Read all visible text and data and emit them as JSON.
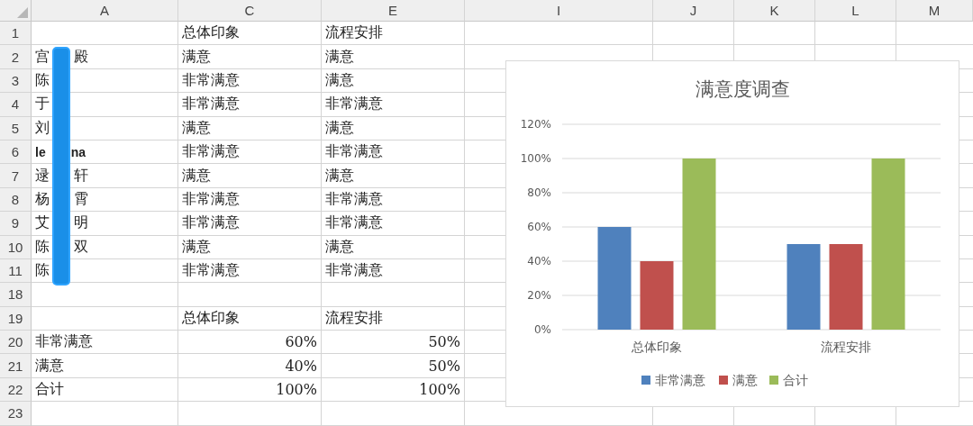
{
  "column_headers": [
    "A",
    "C",
    "E",
    "I",
    "J",
    "K",
    "L",
    "M"
  ],
  "rows": [
    {
      "row": "1",
      "name": [],
      "c": "总体印象",
      "e": "流程安排"
    },
    {
      "row": "2",
      "name": [
        "宫",
        "殿"
      ],
      "c": "满意",
      "e": "满意"
    },
    {
      "row": "3",
      "name": [
        "陈"
      ],
      "c": "非常满意",
      "e": "满意"
    },
    {
      "row": "4",
      "name": [
        "于"
      ],
      "c": "非常满意",
      "e": "非常满意"
    },
    {
      "row": "5",
      "name": [
        "刘"
      ],
      "c": "满意",
      "e": "满意"
    },
    {
      "row": "6",
      "kind": "latin",
      "name": [
        "le",
        "na"
      ],
      "c": "非常满意",
      "e": "非常满意"
    },
    {
      "row": "7",
      "name": [
        "逯",
        "轩"
      ],
      "c": "满意",
      "e": "满意"
    },
    {
      "row": "8",
      "name": [
        "杨",
        "霄"
      ],
      "c": "非常满意",
      "e": "非常满意"
    },
    {
      "row": "9",
      "name": [
        "艾",
        "明"
      ],
      "c": "非常满意",
      "e": "非常满意"
    },
    {
      "row": "10",
      "name": [
        "陈",
        "双"
      ],
      "c": "满意",
      "e": "满意"
    },
    {
      "row": "11",
      "name": [
        "陈"
      ],
      "c": "非常满意",
      "e": "非常满意"
    },
    {
      "row": "18",
      "name": [],
      "c": "",
      "e": ""
    },
    {
      "row": "19",
      "name": [],
      "c": "总体印象",
      "e": "流程安排"
    },
    {
      "row": "20",
      "name": [
        "非常满意"
      ],
      "c": "60%",
      "e": "50%",
      "kind": "numeric"
    },
    {
      "row": "21",
      "name": [
        "满意"
      ],
      "c": "40%",
      "e": "50%",
      "kind": "numeric"
    },
    {
      "row": "22",
      "name": [
        "合计"
      ],
      "c": "100%",
      "e": "100%",
      "kind": "numeric"
    },
    {
      "row": "23",
      "name": [],
      "c": "",
      "e": ""
    }
  ],
  "chart": {
    "chart_data": {
      "type": "bar",
      "title": "满意度调查",
      "categories": [
        "总体印象",
        "流程安排"
      ],
      "series": [
        {
          "name": "非常满意",
          "color": "#4f81bd",
          "values": [
            0.6,
            0.5
          ]
        },
        {
          "name": "满意",
          "color": "#c0504d",
          "values": [
            0.4,
            0.5
          ]
        },
        {
          "name": "合计",
          "color": "#9bbb59",
          "values": [
            1.0,
            1.0
          ]
        }
      ],
      "ylim": [
        0,
        1.2
      ],
      "grid": true,
      "legend": true,
      "yticks": [
        {
          "value": 0,
          "label": "0%"
        },
        {
          "value": 0.2,
          "label": "20%"
        },
        {
          "value": 0.4,
          "label": "40%"
        },
        {
          "value": 0.6,
          "label": "60%"
        },
        {
          "value": 0.8,
          "label": "80%"
        },
        {
          "value": 1.0,
          "label": "100%"
        },
        {
          "value": 1.2,
          "label": "120%"
        }
      ]
    }
  }
}
